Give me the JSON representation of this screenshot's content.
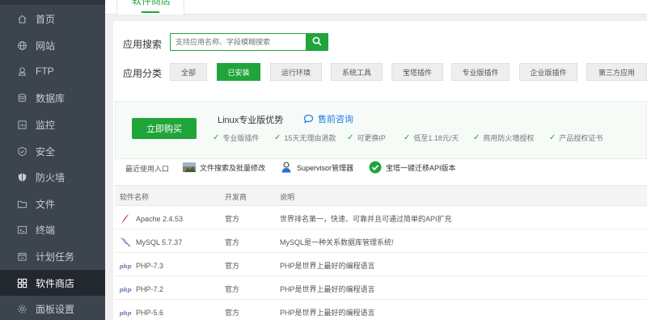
{
  "sidebar": {
    "items": [
      {
        "label": "首页",
        "icon": "home-icon"
      },
      {
        "label": "网站",
        "icon": "globe-icon"
      },
      {
        "label": "FTP",
        "icon": "ftp-icon"
      },
      {
        "label": "数据库",
        "icon": "database-icon"
      },
      {
        "label": "监控",
        "icon": "monitor-icon"
      },
      {
        "label": "安全",
        "icon": "shield-icon"
      },
      {
        "label": "防火墙",
        "icon": "firewall-icon"
      },
      {
        "label": "文件",
        "icon": "folder-icon"
      },
      {
        "label": "终端",
        "icon": "terminal-icon"
      },
      {
        "label": "计划任务",
        "icon": "calendar-icon"
      },
      {
        "label": "软件商店",
        "icon": "grid-icon",
        "active": true
      },
      {
        "label": "面板设置",
        "icon": "gear-icon"
      }
    ]
  },
  "tabs": {
    "active_label": "软件商店"
  },
  "search": {
    "label": "应用搜索",
    "placeholder": "支持应用名称、字段模糊搜索"
  },
  "category": {
    "label": "应用分类",
    "items": [
      "全部",
      "已安装",
      "运行环境",
      "系统工具",
      "宝塔插件",
      "专业版插件",
      "企业版插件",
      "第三方应用"
    ],
    "selected": "已安装"
  },
  "promo": {
    "buy_label": "立即购买",
    "title": "Linux专业版优势",
    "consult_label": "售前咨询",
    "features": [
      "专业版插件",
      "15天无理由退款",
      "可更换IP",
      "低至1.18元/天",
      "商用防火墙授权",
      "产品授权证书"
    ]
  },
  "recent": {
    "label": "最近使用入口",
    "items": [
      "文件搜索及批量修改",
      "Supervisor管理器",
      "宝塔一键迁移API版本"
    ]
  },
  "table": {
    "headers": [
      "软件名称",
      "开发商",
      "说明"
    ],
    "rows": [
      {
        "name": "Apache 2.4.53",
        "vendor": "官方",
        "desc": "世界排名第一，快速、可靠并且可通过简单的API扩充",
        "icon": "apache-feather-icon"
      },
      {
        "name": "MySQL 5.7.37",
        "vendor": "官方",
        "desc": "MySQL是一种关系数据库管理系统!",
        "icon": "mysql-dolphin-icon"
      },
      {
        "name": "PHP-7.3",
        "vendor": "官方",
        "desc": "PHP是世界上最好的编程语言",
        "icon": "php-icon"
      },
      {
        "name": "PHP-7.2",
        "vendor": "官方",
        "desc": "PHP是世界上最好的编程语言",
        "icon": "php-icon"
      },
      {
        "name": "PHP-5.6",
        "vendor": "官方",
        "desc": "PHP是世界上最好的编程语言",
        "icon": "php-icon"
      }
    ]
  },
  "colors": {
    "accent": "#20a53a",
    "sidebar_bg": "#3c444d",
    "sidebar_active": "#22282e",
    "link_blue": "#1a7be8"
  }
}
